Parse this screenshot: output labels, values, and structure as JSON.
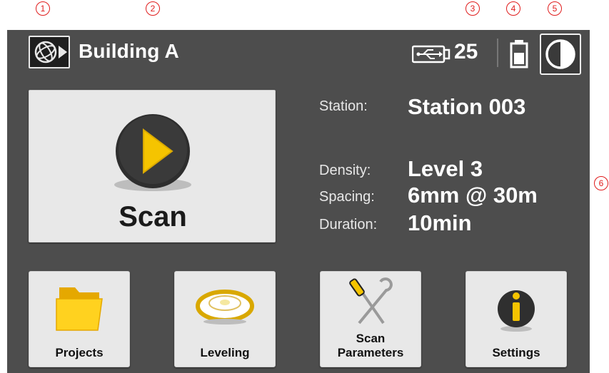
{
  "callouts": {
    "c1": "1",
    "c2": "2",
    "c3": "3",
    "c4": "4",
    "c5": "5",
    "c6": "6"
  },
  "header": {
    "logo_icon": "trimble-globe-logo-icon",
    "title": "Building A",
    "usb_icon": "usb-icon",
    "usb_count": "25",
    "battery_icon": "battery-icon",
    "contrast_icon": "contrast-icon"
  },
  "scan_button": {
    "label": "Scan",
    "icon": "play-icon"
  },
  "station": {
    "label": "Station:",
    "value": "Station 003"
  },
  "params": {
    "density_label": "Density:",
    "density_value": "Level 3",
    "spacing_label": "Spacing:",
    "spacing_value": "6mm @ 30m",
    "duration_label": "Duration:",
    "duration_value": "10min"
  },
  "tiles": {
    "projects": {
      "label": "Projects",
      "icon": "folder-icon"
    },
    "leveling": {
      "label": "Leveling",
      "icon": "level-bubble-icon"
    },
    "scan_parameters": {
      "label_line1": "Scan",
      "label_line2": "Parameters",
      "icon": "tools-icon"
    },
    "settings": {
      "label": "Settings",
      "icon": "info-icon"
    }
  },
  "colors": {
    "screen_bg": "#4d4d4d",
    "button_bg": "#e8e8e8",
    "accent_yellow": "#f5c400",
    "callout_red": "#e01c1c"
  }
}
